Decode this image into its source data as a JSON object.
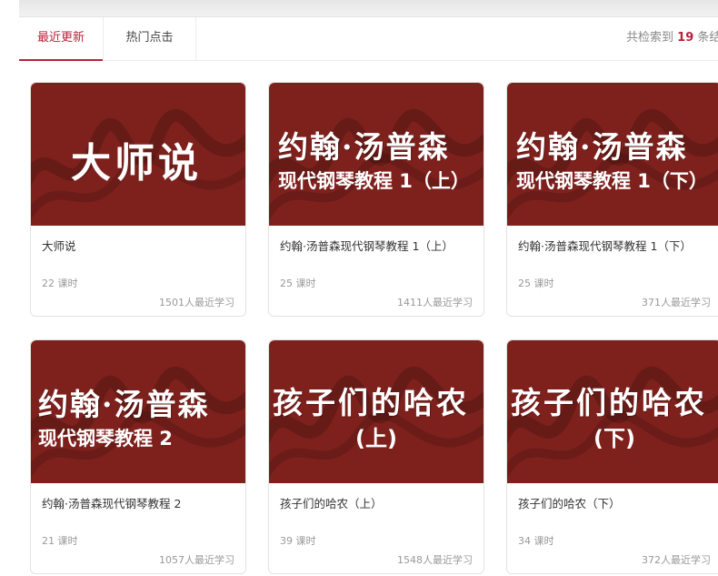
{
  "tabs": {
    "recent_label": "最近更新",
    "hot_label": "热门点击"
  },
  "results": {
    "prefix": "共检索到",
    "count": "19",
    "suffix": "条结"
  },
  "colors": {
    "accent": "#b8233a",
    "cover_bg": "#7e211d"
  },
  "courses": [
    {
      "cover_line1": "大师说",
      "cover_line2": "",
      "title": "大师说",
      "lessons": "22 课时",
      "learners": "1501人最近学习"
    },
    {
      "cover_line1": "约翰·汤普森",
      "cover_line2": "现代钢琴教程 1（上）",
      "title": "约翰·汤普森现代钢琴教程 1（上）",
      "lessons": "25 课时",
      "learners": "1411人最近学习"
    },
    {
      "cover_line1": "约翰·汤普森",
      "cover_line2": "现代钢琴教程 1（下）",
      "title": "约翰·汤普森现代钢琴教程 1（下）",
      "lessons": "25 课时",
      "learners": "371人最近学习"
    },
    {
      "cover_line1": "约翰·汤普森",
      "cover_line2": "现代钢琴教程 2",
      "title": "约翰·汤普森现代钢琴教程 2",
      "lessons": "21 课时",
      "learners": "1057人最近学习"
    },
    {
      "cover_line1": "孩子们的哈农",
      "cover_line2": "(上)",
      "title": "孩子们的哈农（上）",
      "lessons": "39 课时",
      "learners": "1548人最近学习"
    },
    {
      "cover_line1": "孩子们的哈农",
      "cover_line2": "(下)",
      "title": "孩子们的哈农（下）",
      "lessons": "34 课时",
      "learners": "372人最近学习"
    }
  ]
}
